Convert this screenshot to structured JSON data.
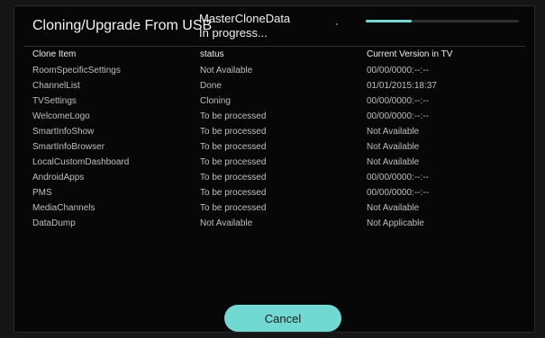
{
  "header": {
    "title": "Cloning/Upgrade From USB",
    "job_name": "MasterCloneData",
    "job_status": "In progress...",
    "progress": 0.3,
    "progress_color": "#79d8d3"
  },
  "table": {
    "columns": [
      "Clone Item",
      "status",
      "Current Version in TV"
    ],
    "rows": [
      {
        "item": "RoomSpecificSettings",
        "status": "Not Available",
        "version": "00/00/0000:--:--"
      },
      {
        "item": "ChannelList",
        "status": "Done",
        "version": "01/01/2015:18:37"
      },
      {
        "item": "TVSettings",
        "status": "Cloning",
        "version": "00/00/0000:--:--"
      },
      {
        "item": "WelcomeLogo",
        "status": "To be processed",
        "version": "00/00/0000:--:--"
      },
      {
        "item": "SmartInfoShow",
        "status": "To be processed",
        "version": "Not Available"
      },
      {
        "item": "SmartInfoBrowser",
        "status": "To be processed",
        "version": "Not Available"
      },
      {
        "item": "LocalCustomDashboard",
        "status": "To be processed",
        "version": "Not Available"
      },
      {
        "item": "AndroidApps",
        "status": "To be processed",
        "version": "00/00/0000:--:--"
      },
      {
        "item": "PMS",
        "status": "To be processed",
        "version": "00/00/0000:--:--"
      },
      {
        "item": "MediaChannels",
        "status": "To be processed",
        "version": "Not Available"
      },
      {
        "item": "DataDump",
        "status": "Not Available",
        "version": "Not Applicable"
      }
    ]
  },
  "footer": {
    "cancel_label": "Cancel",
    "button_color": "#71d9d2"
  }
}
